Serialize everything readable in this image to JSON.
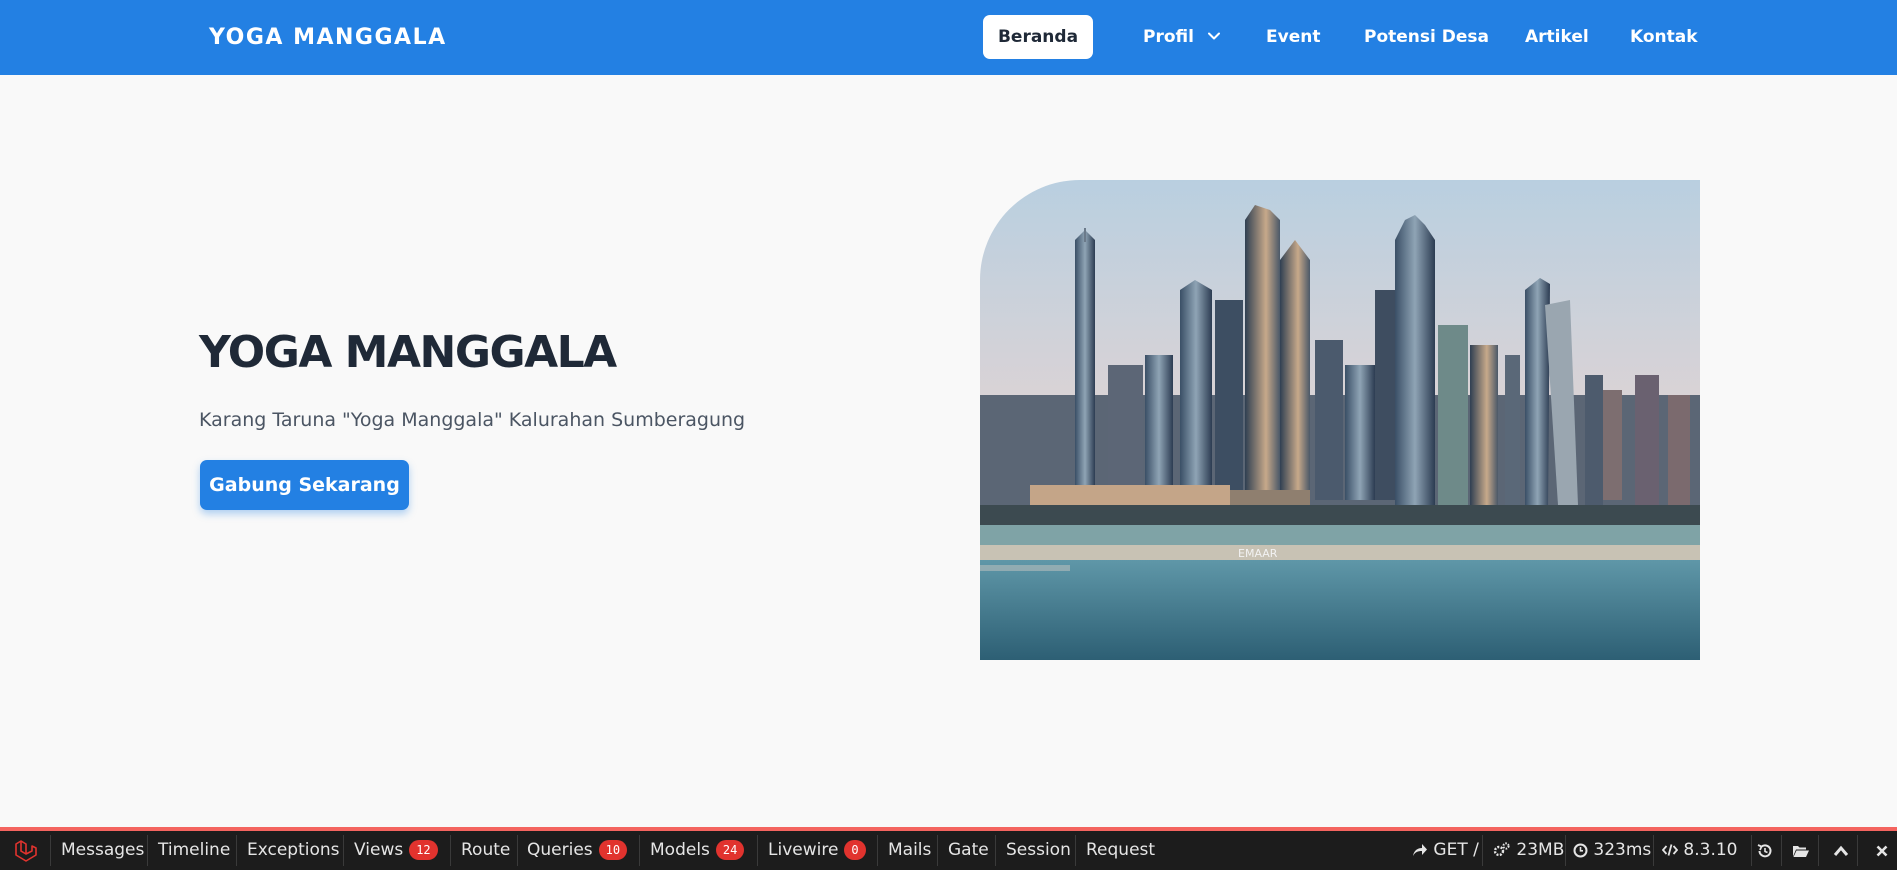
{
  "navbar": {
    "brand": "YOGA MANGGALA",
    "items": [
      {
        "label": "Beranda",
        "active": true
      },
      {
        "label": "Profil",
        "dropdown": true
      },
      {
        "label": "Event"
      },
      {
        "label": "Potensi Desa"
      },
      {
        "label": "Artikel"
      },
      {
        "label": "Kontak"
      }
    ]
  },
  "hero": {
    "title": "YOGA MANGGALA",
    "subtitle": "Karang Taruna \"Yoga Manggala\" Kalurahan Sumberagung",
    "button": "Gabung Sekarang",
    "image_text": "EMAAR"
  },
  "debugbar": {
    "tabs": [
      {
        "label": "Messages"
      },
      {
        "label": "Timeline"
      },
      {
        "label": "Exceptions"
      },
      {
        "label": "Views",
        "badge": "12"
      },
      {
        "label": "Route"
      },
      {
        "label": "Queries",
        "badge": "10"
      },
      {
        "label": "Models",
        "badge": "24"
      },
      {
        "label": "Livewire",
        "badge": "0"
      },
      {
        "label": "Mails"
      },
      {
        "label": "Gate"
      },
      {
        "label": "Session"
      },
      {
        "label": "Request"
      }
    ],
    "request": "GET /",
    "memory": "23MB",
    "time": "323ms",
    "version": "8.3.10"
  },
  "colors": {
    "primary": "#2380e3",
    "title": "#1f2937",
    "debugbar_bg": "#1c1c1c",
    "badge": "#e1332e",
    "accent_red": "#f4645f"
  }
}
